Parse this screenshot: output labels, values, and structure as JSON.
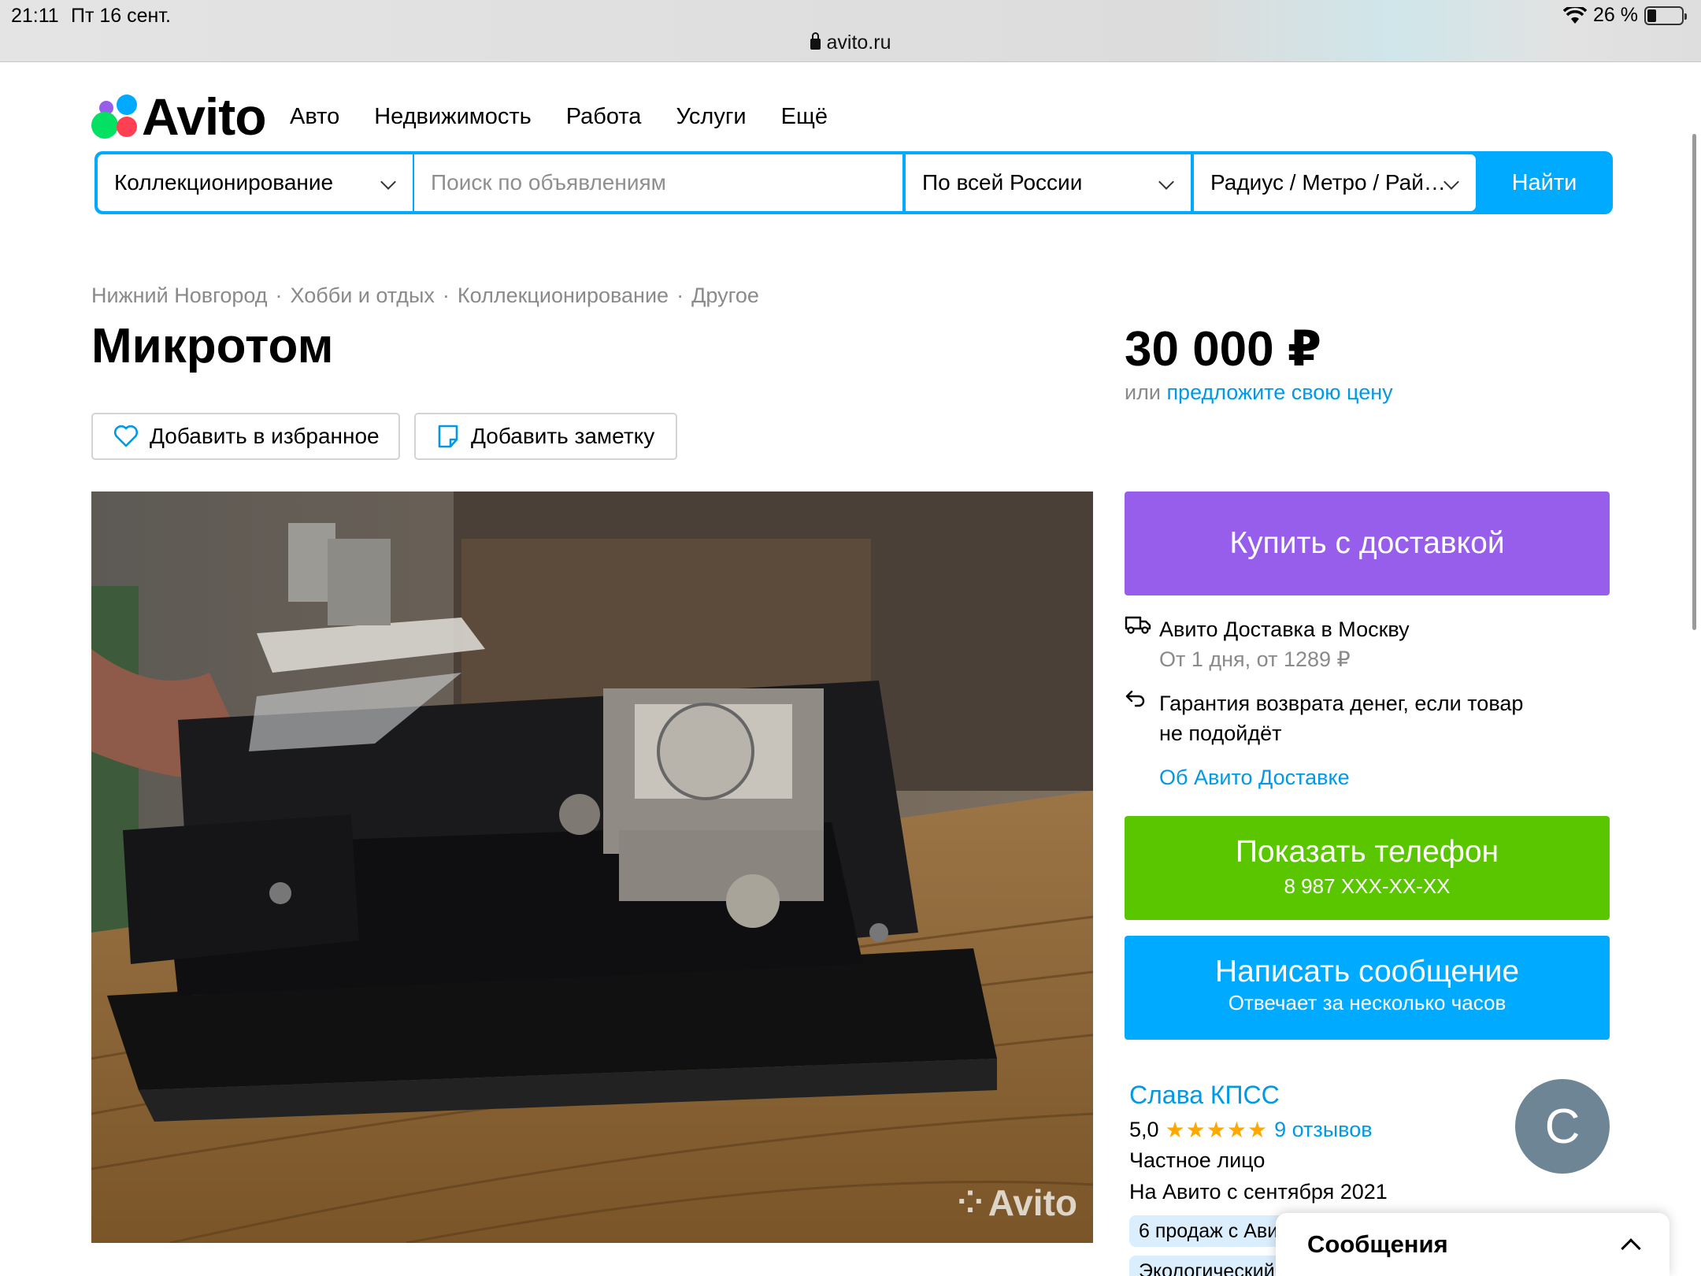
{
  "status_bar": {
    "time": "21:11",
    "date": "Пт 16 сент.",
    "url": "avito.ru",
    "battery": "26 %",
    "battery_level": 0.26
  },
  "header": {
    "logo_text": "Avito",
    "nav": [
      "Авто",
      "Недвижимость",
      "Работа",
      "Услуги",
      "Ещё"
    ]
  },
  "search": {
    "category": "Коллекционирование",
    "placeholder": "Поиск по объявлениям",
    "region": "По всей России",
    "radius": "Радиус / Метро / Рай…",
    "button": "Найти"
  },
  "breadcrumb": [
    "Нижний Новгород",
    "Хобби и отдых",
    "Коллекционирование",
    "Другое"
  ],
  "listing": {
    "title": "Микротом",
    "price": "30 000 ₽",
    "price_prefix": "или",
    "offer_link": "предложите свою цену",
    "add_favorite": "Добавить в избранное",
    "add_note": "Добавить заметку",
    "watermark": "Avito"
  },
  "sidebar": {
    "buy_button": "Купить с доставкой",
    "delivery_title": "Авито Доставка в Москву",
    "delivery_sub": "От 1 дня, от 1289 ₽",
    "guarantee_line1": "Гарантия возврата денег, если товар",
    "guarantee_line2": "не подойдёт",
    "about_delivery": "Об Авито Доставке",
    "phone_button": "Показать телефон",
    "phone_number": "8 987 XXX-XX-XX",
    "message_button": "Написать сообщение",
    "message_sub": "Отвечает за несколько часов"
  },
  "seller": {
    "name": "Слава КПСС",
    "rating": "5,0",
    "stars": "★★★★★",
    "reviews": "9 отзывов",
    "type": "Частное лицо",
    "since": "На Авито с сентября 2021",
    "avatar_letter": "С",
    "tag1": "6 продаж с Ави",
    "tag2": "Экологический"
  },
  "messages_panel": {
    "title": "Сообщения"
  },
  "colors": {
    "accent_blue": "#00aaff",
    "buy_purple": "#965eeb",
    "phone_green": "#5ac600",
    "link_blue": "#0099e6"
  }
}
